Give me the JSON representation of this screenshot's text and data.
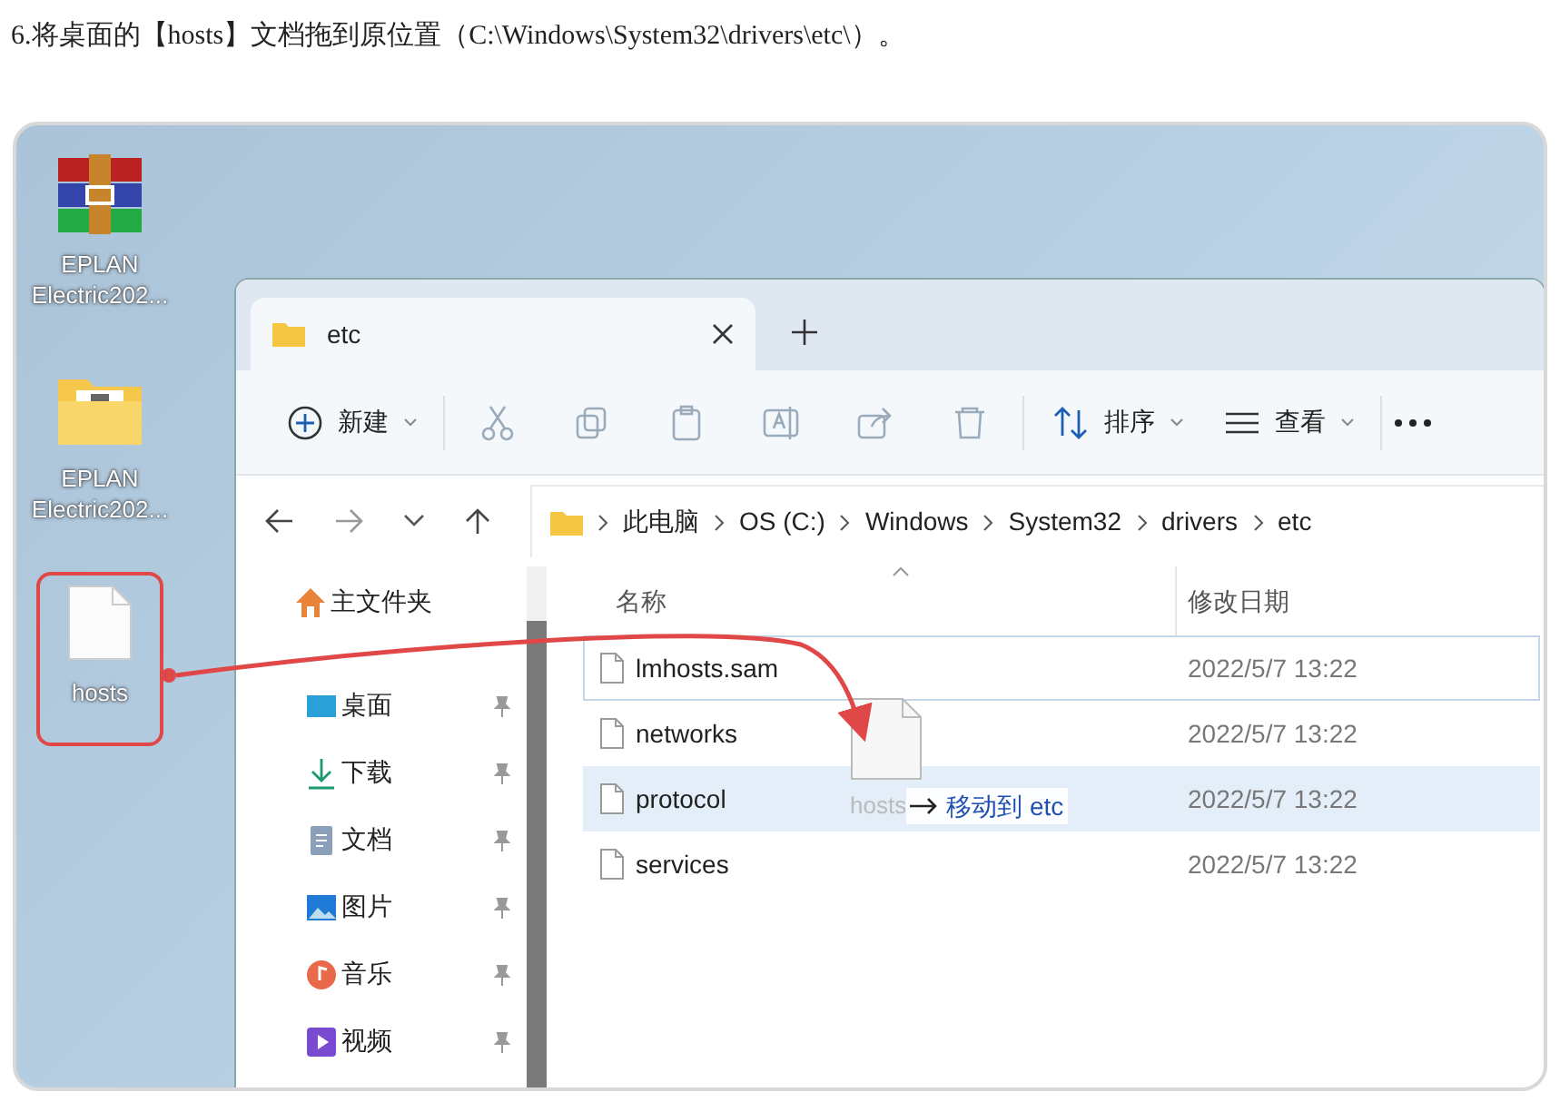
{
  "instruction": "6.将桌面的【hosts】文档拖到原位置（C:\\Windows\\System32\\drivers\\etc\\）。",
  "desktop": {
    "icons": [
      {
        "kind": "archive",
        "label": "EPLAN Electric202...",
        "highlighted": false
      },
      {
        "kind": "folder",
        "label": "EPLAN Electric202...",
        "highlighted": false
      },
      {
        "kind": "file",
        "label": "hosts",
        "highlighted": true
      }
    ]
  },
  "explorer": {
    "tabs": [
      {
        "label": "etc",
        "selected": true
      }
    ],
    "toolbar": [
      {
        "kind": "new",
        "label": "新建"
      },
      {
        "kind": "cut"
      },
      {
        "kind": "copy"
      },
      {
        "kind": "paste"
      },
      {
        "kind": "rename"
      },
      {
        "kind": "share"
      },
      {
        "kind": "delete"
      },
      {
        "kind": "sort",
        "label": "排序"
      },
      {
        "kind": "view",
        "label": "查看"
      },
      {
        "kind": "more"
      }
    ],
    "breadcrumb": [
      "此电脑",
      "OS (C:)",
      "Windows",
      "System32",
      "drivers",
      "etc"
    ],
    "sidebar": {
      "sections": [
        [
          {
            "kind": "home",
            "label": "主文件夹",
            "pinned": false
          }
        ],
        [
          {
            "kind": "desktop",
            "label": "桌面",
            "pinned": true
          },
          {
            "kind": "download",
            "label": "下载",
            "pinned": true
          },
          {
            "kind": "document",
            "label": "文档",
            "pinned": true
          },
          {
            "kind": "picture",
            "label": "图片",
            "pinned": true
          },
          {
            "kind": "music",
            "label": "音乐",
            "pinned": true
          },
          {
            "kind": "video",
            "label": "视频",
            "pinned": true
          }
        ]
      ]
    },
    "columns": [
      "名称",
      "修改日期"
    ],
    "files": [
      {
        "name": "lmhosts.sam",
        "date": "2022/5/7 13:22",
        "selected": false,
        "focused": true
      },
      {
        "name": "networks",
        "date": "2022/5/7 13:22",
        "selected": false,
        "focused": false
      },
      {
        "name": "protocol",
        "date": "2022/5/7 13:22",
        "selected": true,
        "focused": false
      },
      {
        "name": "services",
        "date": "2022/5/7 13:22",
        "selected": false,
        "focused": false
      }
    ],
    "drag": {
      "file": "hosts",
      "action": "移动到 etc"
    }
  }
}
